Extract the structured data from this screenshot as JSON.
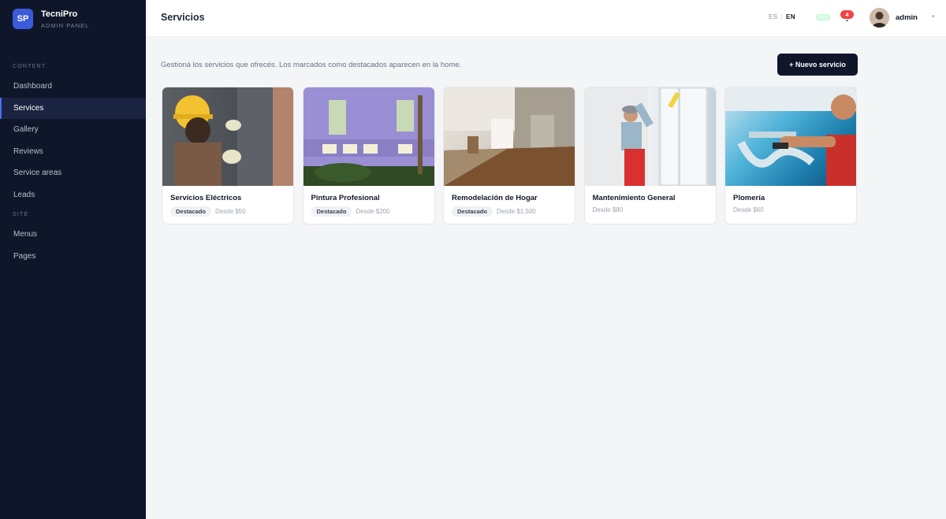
{
  "brand": {
    "logo_text": "SP",
    "name": "TecniPro",
    "subtitle": "ADMIN PANEL"
  },
  "sidebar": {
    "content_label": "CONTENT",
    "content_items": [
      {
        "label": "Dashboard",
        "active": false
      },
      {
        "label": "Services",
        "active": true
      },
      {
        "label": "Gallery",
        "active": false
      },
      {
        "label": "Reviews",
        "active": false
      },
      {
        "label": "Service areas",
        "active": false
      },
      {
        "label": "Leads",
        "active": false
      }
    ],
    "site_label": "SITE",
    "site_items": [
      {
        "label": "Menus"
      },
      {
        "label": "Pages"
      }
    ]
  },
  "header": {
    "title": "Servicios",
    "lang_es": "ES",
    "lang_en": "EN",
    "lang_active": "EN",
    "notifications_count": "4",
    "user_name": "admin"
  },
  "main": {
    "intro": "Gestioná los servicios que ofrecés. Los marcados como destacados aparecen en la home.",
    "new_button_label": "+ Nuevo servicio",
    "services": [
      {
        "title": "Servicios Eléctricos",
        "tag": "Destacado",
        "price": "Desde $50",
        "image_icon": "electrician-photo"
      },
      {
        "title": "Pintura Profesional",
        "tag": "Destacado",
        "price": "Desde $200",
        "image_icon": "painting-photo"
      },
      {
        "title": "Remodelación de Hogar",
        "tag": "Destacado",
        "price": "Desde $1,500",
        "image_icon": "remodel-photo"
      },
      {
        "title": "Mantenimiento General",
        "tag": "",
        "price": "Desde $80",
        "image_icon": "maintenance-photo"
      },
      {
        "title": "Plomería",
        "tag": "",
        "price": "Desde $60",
        "image_icon": "plumbing-photo"
      }
    ]
  },
  "colors": {
    "sidebar_bg": "#0f1629",
    "accent": "#3b5bdb",
    "primary_button": "#0f1629",
    "notification_badge": "#ef4444",
    "page_bg": "#f4f5f7"
  }
}
